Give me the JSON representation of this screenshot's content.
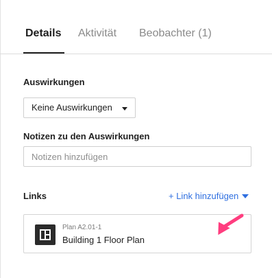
{
  "tabs": [
    {
      "label": "Details",
      "active": true
    },
    {
      "label": "Aktivität",
      "active": false
    },
    {
      "label": "Beobachter (1)",
      "active": false
    }
  ],
  "impact": {
    "label": "Auswirkungen",
    "selected": "Keine Auswirkungen"
  },
  "notes": {
    "label": "Notizen zu den Auswirkungen",
    "placeholder": "Notizen hinzufügen",
    "value": ""
  },
  "links": {
    "label": "Links",
    "add_label": "+ Link hinzufügen",
    "items": [
      {
        "subtitle": "Plan A2.01-1",
        "title": "Building 1 Floor Plan",
        "icon": "floor-plan-icon"
      }
    ]
  },
  "colors": {
    "accent": "#2f6fe0",
    "annotation_arrow": "#ff3d7f",
    "icon_bg": "#2b2b2b"
  }
}
